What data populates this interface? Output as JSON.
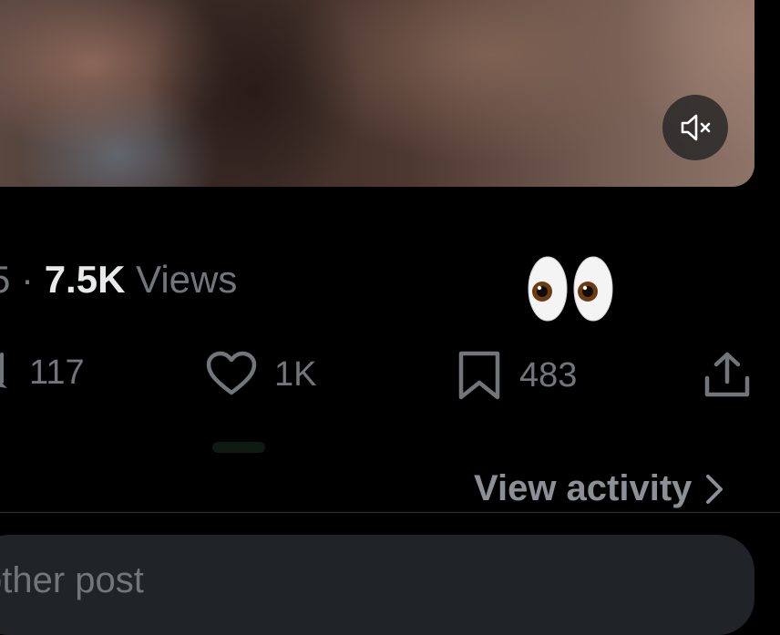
{
  "video": {
    "mute_icon": "speaker-muted-icon"
  },
  "meta": {
    "left_fragment": "5",
    "separator": "·",
    "views_count": "7.5K",
    "views_label": "Views"
  },
  "reaction": {
    "emoji": "👀"
  },
  "actions": {
    "repost_count": "117",
    "like_count": "1K",
    "bookmark_count": "483",
    "icons": [
      "repost-icon",
      "heart-icon",
      "bookmark-icon",
      "share-icon"
    ]
  },
  "activity": {
    "label": "View activity"
  },
  "reply": {
    "placeholder": "Post your reply... another post",
    "visible_placeholder": "other post"
  },
  "colors": {
    "background": "#000000",
    "muted_text": "#71767b",
    "primary_text": "#e7e9ea",
    "input_bg": "#202327",
    "divider": "#2f3336"
  }
}
